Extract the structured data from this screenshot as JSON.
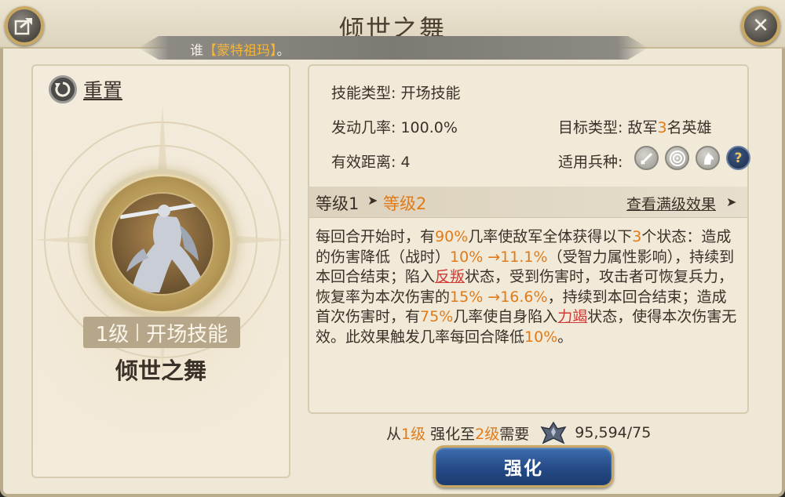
{
  "window": {
    "title": "倾世之舞",
    "share_icon": "share-icon",
    "close_icon": "close-icon"
  },
  "owner": {
    "prefix": "谁",
    "name": "【蒙特祖玛】",
    "suffix": "。"
  },
  "left": {
    "reset_label": "重置",
    "level_label": "1级",
    "skill_category": "开场技能",
    "skill_name": "倾世之舞",
    "emblem_icon": "dancer-with-sword-icon"
  },
  "info": {
    "skill_type_label": "技能类型:",
    "skill_type_value": "开场技能",
    "activation_label": "发动几率:",
    "activation_value": "100.0%",
    "range_label": "有效距离:",
    "range_value": "4",
    "target_label": "目标类型:",
    "target_prefix": "敌军",
    "target_count": "3",
    "target_suffix": "名英雄",
    "troops_label": "适用兵种:",
    "troop_icons": [
      "infantry-sword-icon",
      "archer-target-icon",
      "cavalry-horse-icon",
      "help-question-icon"
    ]
  },
  "levels": {
    "from": "等级1",
    "to": "等级2",
    "arrow": "➤",
    "view_max_label": "查看满级效果",
    "view_max_arrow": "➤"
  },
  "description": {
    "p1": "每回合开始时，有",
    "v1": "90%",
    "p2": "几率使敌军全体获得以下",
    "v2": "3",
    "p3": "个状态：造成的伤害降低（战时）",
    "v3": "10% →11.1%",
    "p4": "（受智力属性影响），持续到本回合结束；陷入",
    "k1": "反叛",
    "p5": "状态，受到伤害时，攻击者可恢复兵力，恢复率为本次伤害的",
    "v4": "15% →16.6%",
    "p6": "，持续到本回合结束；造成首次伤害时，有",
    "v5": "75%",
    "p7": "几率使自身陷入",
    "k2": "力竭",
    "p8": "状态，使得本次伤害无效。此效果触发几率每回合降低",
    "v6": "10%",
    "p9": "。"
  },
  "cost": {
    "from_word": "从",
    "from_level": "1级",
    "mid": "强化至",
    "to_level": "2级",
    "need": "需要",
    "icon": "skill-scroll-icon",
    "amount": "95,594/75"
  },
  "upgrade_button": "强化",
  "colors": {
    "accent_orange": "#e07b1a",
    "keyword_red": "#d03a34",
    "button_blue": "#2c5394",
    "gold_border": "#c9a864",
    "owner_name": "#f3b53a"
  }
}
